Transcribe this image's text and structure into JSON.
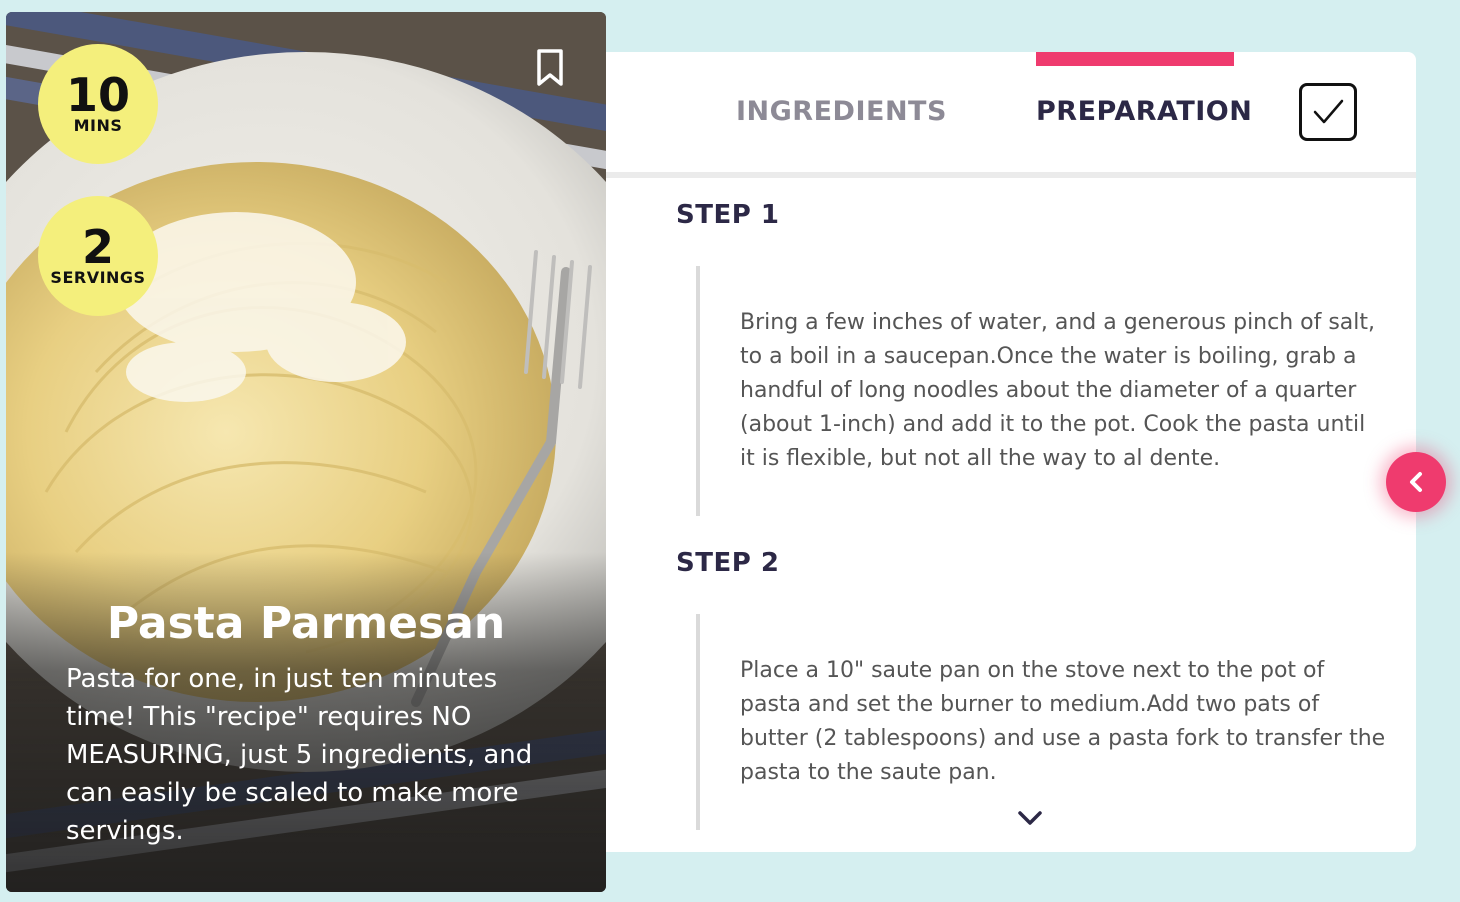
{
  "recipe": {
    "title": "Pasta Parmesan",
    "description": "Pasta for one, in just ten minutes time! This \"recipe\" requires NO MEASURING, just 5 ingredients, and can easily be scaled to make more servings.",
    "time": {
      "value": "10",
      "unit": "MINS"
    },
    "servings": {
      "value": "2",
      "unit": "SERVINGS"
    }
  },
  "tabs": {
    "ingredients": "INGREDIENTS",
    "preparation": "PREPARATION",
    "active": "preparation"
  },
  "steps": [
    {
      "title": "STEP 1",
      "text": "Bring a few inches of water, and a generous pinch of salt, to a boil in a saucepan.Once the water is boiling, grab a handful of long noodles about the diameter of a quarter (about 1-inch) and add it to the pot. Cook the pasta until it is flexible, but not all the way to al dente."
    },
    {
      "title": "STEP 2",
      "text": "Place a 10\" saute pan on the stove next to the pot of pasta and set the burner to medium.Add two pats of butter (2 tablespoons) and use a pasta fork to transfer the pasta to the saute pan."
    }
  ],
  "icons": {
    "bookmark": "bookmark-icon",
    "check": "checkmark-icon",
    "back": "chevron-left-icon",
    "more": "chevron-down-icon"
  },
  "colors": {
    "background": "#d5eff0",
    "accent": "#ef3b6e",
    "badge": "#f4ef7c",
    "heading": "#2c2846",
    "tab_inactive": "#8d8a96"
  }
}
